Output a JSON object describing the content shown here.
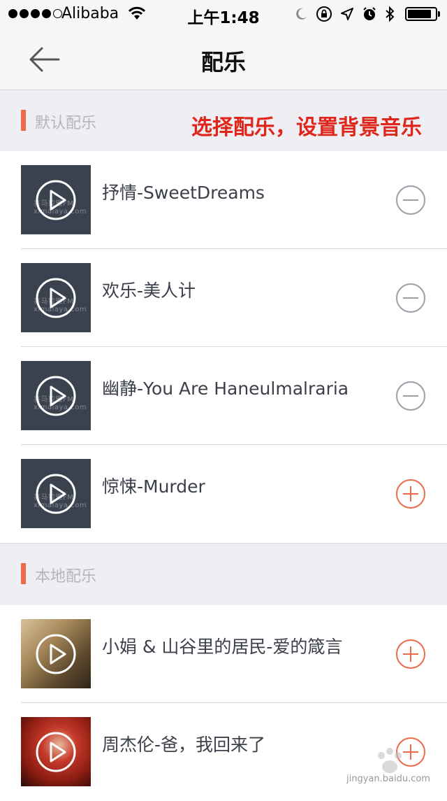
{
  "status_bar": {
    "carrier": "Alibaba",
    "time": "上午1:48"
  },
  "nav": {
    "title": "配乐",
    "back_icon": "arrow-left-icon"
  },
  "sections": [
    {
      "label": "默认配乐",
      "annotation": "选择配乐，设置背景音乐",
      "items": [
        {
          "title": "抒情-SweetDreams",
          "action": "remove"
        },
        {
          "title": "欢乐-美人计",
          "action": "remove"
        },
        {
          "title": "幽静-You Are Haneulmalraria",
          "action": "remove"
        },
        {
          "title": "惊悚-Murder",
          "action": "add"
        }
      ]
    },
    {
      "label": "本地配乐",
      "items": [
        {
          "title": "小娟 & 山谷里的居民-爱的箴言",
          "action": "add"
        },
        {
          "title": "周杰伦-爸，我回来了",
          "action": "add"
        }
      ]
    }
  ],
  "thumbnail_watermark": "喜马拉雅FM ximalaya.com",
  "page_watermark": "jingyan.baidu.com",
  "colors": {
    "accent": "#ee6a4a",
    "annotation": "#e0251b",
    "remove_icon": "#9aa0a8",
    "section_bg": "#efeef3"
  }
}
